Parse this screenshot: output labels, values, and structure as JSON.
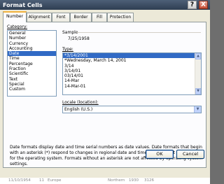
{
  "window": {
    "title": "Format Cells",
    "help_glyph": "?",
    "close_glyph": "X"
  },
  "tabs": [
    "Number",
    "Alignment",
    "Font",
    "Border",
    "Fill",
    "Protection"
  ],
  "category": {
    "label": "Category:",
    "items": [
      "General",
      "Number",
      "Currency",
      "Accounting",
      "Date",
      "Time",
      "Percentage",
      "Fraction",
      "Scientific",
      "Text",
      "Special",
      "Custom"
    ],
    "selected_index": 4
  },
  "sample": {
    "label": "Sample",
    "value": "7/25/1958"
  },
  "type": {
    "label": "Type:",
    "items": [
      "*3/14/2001",
      "*Wednesday, March 14, 2001",
      "3/14",
      "3/14/01",
      "03/14/01",
      "14-Mar",
      "14-Mar-01"
    ],
    "selected_index": 0
  },
  "locale": {
    "label": "Locale (location):",
    "value": "English (U.S.)"
  },
  "description": "Date formats display date and time serial numbers as date values.  Date formats that begin with an asterisk (*) respond to changes in regional date and time settings that are specified for the operating system. Formats without an asterisk are not affected by operating system settings.",
  "buttons": {
    "ok": "OK",
    "cancel": "Cancel"
  },
  "background_row": {
    "c1": "11/10/1954",
    "c2": "11",
    "c3": "Europe",
    "c4": "Northern",
    "c5": "1930",
    "c6": "3126"
  },
  "colors": {
    "selection": "#316ac5",
    "dialog_bg": "#ece9d8",
    "active_tab_accent": "#f1b23b"
  }
}
